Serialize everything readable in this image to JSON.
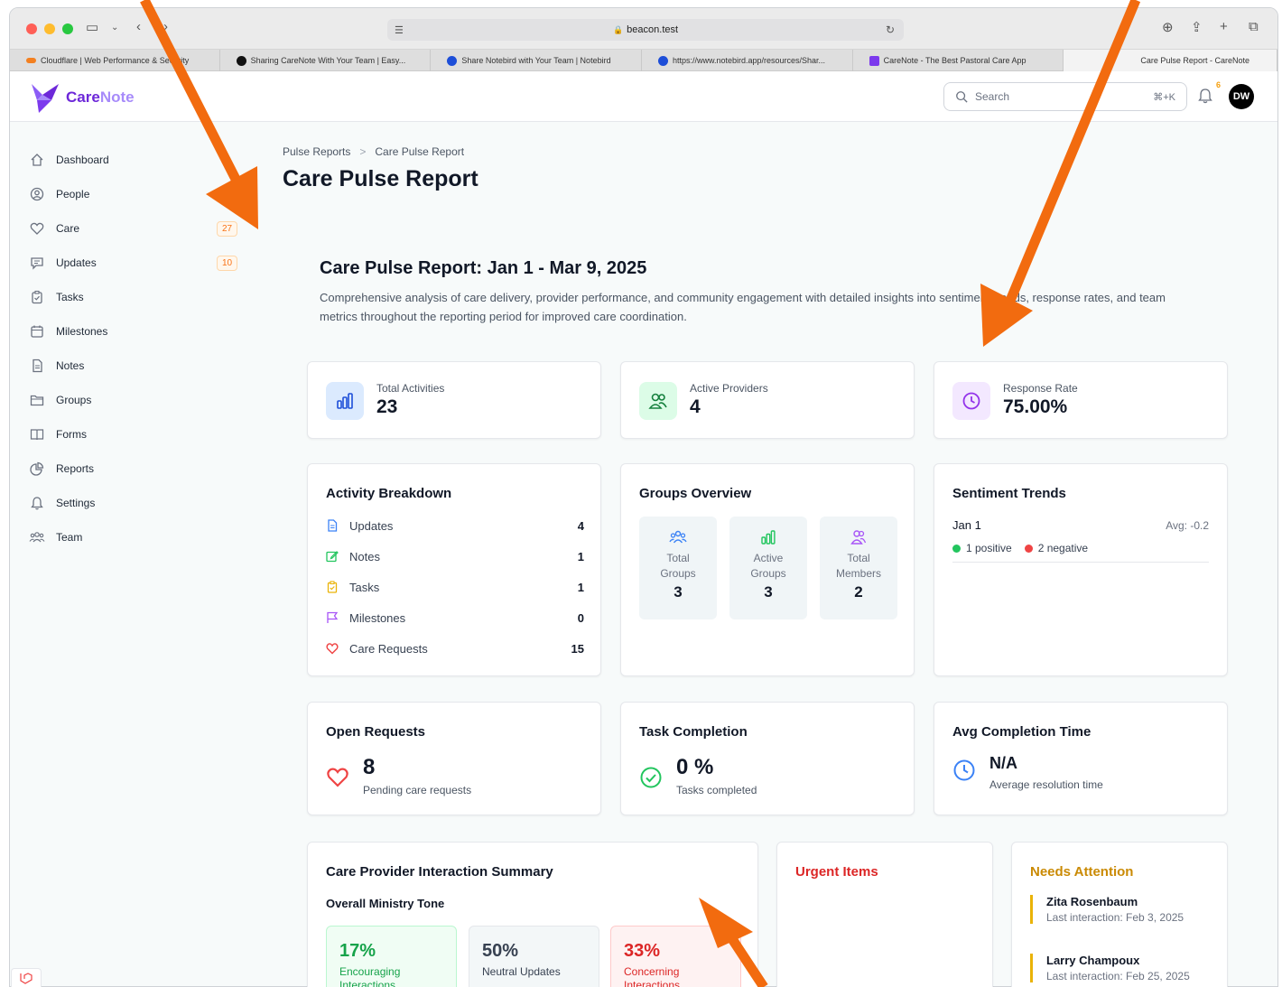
{
  "browser": {
    "url": "beacon.test",
    "tabs": [
      {
        "label": "Cloudflare | Web Performance & Security",
        "color": "#f38020"
      },
      {
        "label": "Sharing CareNote With Your Team | Easy...",
        "color": "#111111"
      },
      {
        "label": "Share Notebird with Your Team | Notebird",
        "color": "#1d4ed8"
      },
      {
        "label": "https://www.notebird.app/resources/Shar...",
        "color": "#1d4ed8"
      },
      {
        "label": "CareNote - The Best Pastoral Care App",
        "color": "#7c3aed"
      },
      {
        "label": "Care Pulse Report - CareNote",
        "color": "#7c3aed"
      }
    ]
  },
  "header": {
    "logo_part1": "Care",
    "logo_part2": "Note",
    "search_placeholder": "Search",
    "search_shortcut": "⌘+K",
    "notif_count": "6",
    "avatar_initials": "DW"
  },
  "sidebar": {
    "items": [
      {
        "label": "Dashboard",
        "icon": "home-icon"
      },
      {
        "label": "People",
        "icon": "user-circle-icon"
      },
      {
        "label": "Care",
        "icon": "heart-icon",
        "badge": "27"
      },
      {
        "label": "Updates",
        "icon": "chat-icon",
        "badge": "10"
      },
      {
        "label": "Tasks",
        "icon": "clipboard-icon"
      },
      {
        "label": "Milestones",
        "icon": "calendar-icon"
      },
      {
        "label": "Notes",
        "icon": "document-icon"
      },
      {
        "label": "Groups",
        "icon": "folder-icon"
      },
      {
        "label": "Forms",
        "icon": "book-icon"
      },
      {
        "label": "Reports",
        "icon": "pie-chart-icon"
      },
      {
        "label": "Settings",
        "icon": "bell-icon"
      },
      {
        "label": "Team",
        "icon": "users-icon"
      }
    ]
  },
  "main": {
    "breadcrumb": [
      "Pulse Reports",
      "Care Pulse Report"
    ],
    "breadcrumb_sep": ">",
    "page_title": "Care Pulse Report",
    "report_title": "Care Pulse Report: Jan 1 - Mar 9, 2025",
    "report_desc": "Comprehensive analysis of care delivery, provider performance, and community engagement with detailed insights into sentiment trends, response rates, and team metrics throughout the reporting period for improved care coordination.",
    "stats": [
      {
        "label": "Total Activities",
        "value": "23",
        "icon": "bar-chart-icon",
        "bg": "#dbeafe",
        "fg": "#1d4ed8"
      },
      {
        "label": "Active Providers",
        "value": "4",
        "icon": "users-icon",
        "bg": "#dcfce7",
        "fg": "#15803d"
      },
      {
        "label": "Response Rate",
        "value": "75.00%",
        "icon": "clock-icon",
        "bg": "#f3e8ff",
        "fg": "#9333ea"
      }
    ],
    "activity_breakdown": {
      "title": "Activity Breakdown",
      "rows": [
        {
          "label": "Updates",
          "value": "4",
          "icon": "document-icon",
          "color": "#3b82f6"
        },
        {
          "label": "Notes",
          "value": "1",
          "icon": "edit-icon",
          "color": "#22c55e"
        },
        {
          "label": "Tasks",
          "value": "1",
          "icon": "clipboard-icon",
          "color": "#eab308"
        },
        {
          "label": "Milestones",
          "value": "0",
          "icon": "flag-icon",
          "color": "#a855f7"
        },
        {
          "label": "Care Requests",
          "value": "15",
          "icon": "heart-icon",
          "color": "#ef4444"
        }
      ]
    },
    "groups_overview": {
      "title": "Groups Overview",
      "tiles": [
        {
          "label1": "Total",
          "label2": "Groups",
          "value": "3",
          "icon": "users-icon",
          "color": "#3b82f6"
        },
        {
          "label1": "Active",
          "label2": "Groups",
          "value": "3",
          "icon": "bar-chart-icon",
          "color": "#22c55e"
        },
        {
          "label1": "Total",
          "label2": "Members",
          "value": "2",
          "icon": "user-group-icon",
          "color": "#a855f7"
        }
      ]
    },
    "sentiment": {
      "title": "Sentiment Trends",
      "date": "Jan 1",
      "avg": "Avg: -0.2",
      "positive": "1 positive",
      "negative": "2 negative",
      "pos_color": "#22c55e",
      "neg_color": "#ef4444"
    },
    "open_requests": {
      "title": "Open Requests",
      "value": "8",
      "sub": "Pending care requests"
    },
    "task_completion": {
      "title": "Task Completion",
      "value": "0 %",
      "sub": "Tasks completed"
    },
    "avg_completion": {
      "title": "Avg Completion Time",
      "value": "N/A",
      "sub": "Average resolution time"
    },
    "interaction_summary": {
      "title": "Care Provider Interaction Summary",
      "tone_label": "Overall Ministry Tone",
      "tones": [
        {
          "pct": "17%",
          "label": "Encouraging Interactions",
          "bg": "#f0fdf4",
          "border": "#bbf7d0",
          "color": "#16a34a"
        },
        {
          "pct": "50%",
          "label": "Neutral Updates",
          "bg": "#f3f7f8",
          "border": "#e5e7eb",
          "color": "#374151"
        },
        {
          "pct": "33%",
          "label": "Concerning Interactions",
          "bg": "#fef2f2",
          "border": "#fecaca",
          "color": "#dc2626"
        }
      ]
    },
    "urgent_items": {
      "title": "Urgent Items"
    },
    "needs_attention": {
      "title": "Needs Attention",
      "people": [
        {
          "name": "Zita Rosenbaum",
          "detail": "Last interaction: Feb 3, 2025"
        },
        {
          "name": "Larry Champoux",
          "detail": "Last interaction: Feb 25, 2025"
        }
      ]
    }
  }
}
